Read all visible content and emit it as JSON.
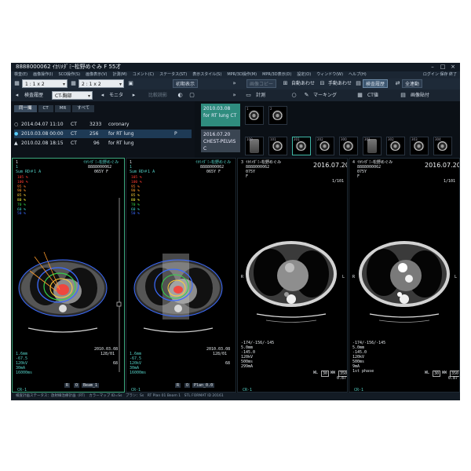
{
  "titlebar": {
    "title": "8888000062  ｲｶﾘﾒﾀﾞﾐｰ松野めぐみ  F   55才"
  },
  "menubar": {
    "items": [
      "検査(E)",
      "画像操作(I)",
      "SCO操作(S)",
      "画像表示(V)",
      "計測(M)",
      "コメント(C)",
      "ステータス(ST)",
      "表示スタイル(S)",
      "MPR/3D操作(M)",
      "MPR/3D表示(D)",
      "設定(O)",
      "ウィンドウ(W)",
      "ヘルプ(H)"
    ],
    "right": "ログイン 保存 終了"
  },
  "toolbar1": {
    "layout1": "1 : 1 x 2",
    "layout2": "2 : 1 x 2",
    "initial_display": "初期表示",
    "series_copy": "画像コピー",
    "auto_fit": "自動あわせ",
    "manual_fit": "手動あわせ",
    "study_history": "検査履歴",
    "full_sync": "全連動"
  },
  "toolbar2": {
    "exam_history": "検査履歴",
    "series_select": "CT-胸部",
    "monitor": "モニタ",
    "compare": "比較読影",
    "measure": "計測",
    "marking": "マーキング",
    "ct_value": "CT値",
    "image_paste": "画像貼付"
  },
  "study_panel": {
    "tabs": [
      "同一撮",
      "CT",
      "MR",
      "すべて"
    ],
    "studies": [
      {
        "date": "2014.04.07 11:10",
        "modality": "CT",
        "count": "3233",
        "desc": "coronary",
        "flag": ""
      },
      {
        "date": "2010.03.08 00:00",
        "modality": "CT",
        "count": "256",
        "desc": "for RT lung",
        "flag": "P"
      },
      {
        "date": "2010.02.08 18:15",
        "modality": "CT",
        "count": "96",
        "desc": "for RT lung",
        "flag": ""
      }
    ]
  },
  "series_bar": {
    "card1": {
      "date": "2010.03.08",
      "desc": "for RT lung CT"
    },
    "card2": {
      "date": "2016.07.20",
      "desc": "CHEST-PELVIS C"
    },
    "thumb_numbers": [
      "1",
      "2",
      "100",
      "101",
      "201",
      "202",
      "300",
      "301",
      "302",
      "303",
      "304"
    ]
  },
  "viewports": {
    "vp1": {
      "index": "1",
      "patient": "ｲｶﾘﾒﾀﾞﾐｰ松野めぐみ",
      "id": "8888000062",
      "age": "065Y F",
      "dose_title": "1",
      "dose_sub": "Sum RD＃1 A",
      "dose_levels": [
        "105 %",
        "100 %",
        "95 %",
        "90 %",
        "85 %",
        "80 %",
        "70 %",
        "60 %",
        "50 %"
      ],
      "date": "2010.03.08",
      "img": "128/01",
      "params": [
        "1.6mm",
        "-67.5",
        "120kV",
        "30mA",
        "16000ms"
      ],
      "wl": "68",
      "btns": [
        "R",
        "O",
        "Beam_1"
      ],
      "series": "CR-1"
    },
    "vp2": {
      "index": "1",
      "patient": "ｲｶﾘﾒﾀﾞﾐｰ松野めぐみ",
      "id": "8888000062",
      "age": "065Y F",
      "dose_title": "1",
      "dose_sub": "Sum RD＃1 A",
      "dose_levels": [
        "105 %",
        "100 %",
        "95 %",
        "90 %",
        "85 %",
        "80 %",
        "70 %",
        "60 %",
        "50 %"
      ],
      "date": "2010.03.08",
      "img": "128/01",
      "params": [
        "1.6mm",
        "-67.5",
        "120kV",
        "30mA",
        "16000ms"
      ],
      "wl": "68",
      "btns": [
        "R",
        "O",
        "Plan_0.0"
      ],
      "series": "CR-1"
    },
    "vp3": {
      "index": "3",
      "patient": "ｲｶﾘﾒﾀﾞﾐｰ松野めぐみ",
      "id": "8888000062",
      "age": "075Y",
      "sex": "F",
      "date": "2016.07.20",
      "page": "1/101",
      "coords": "-174/-156/-145",
      "params": [
        "5.0mm",
        "-145.0",
        "120kV",
        "500ms",
        "299mA"
      ],
      "wl_label": "WL",
      "wl": "30",
      "ww_label": "WW",
      "ww": "350",
      "zoom": "0.87",
      "series": "CR-1"
    },
    "vp4": {
      "index": "4",
      "patient": "ｲｶﾘﾒﾀﾞﾐｰ松野めぐみ",
      "id": "8888000062",
      "age": "075Y",
      "sex": "F",
      "date": "2016.07.20",
      "page": "1/101",
      "coords": "-174/-156/-145",
      "params": [
        "5.0mm",
        "-145.0",
        "120kV",
        "500ms",
        "9mA",
        "1st phase"
      ],
      "wl_label": "WL",
      "wl": "30",
      "ww_label": "WW",
      "ww": "350",
      "zoom": "0.87",
      "series": "CR-1"
    }
  },
  "status": {
    "text": "検査計画ステータス：放射線治療計画（RT）　カラーマップ ID=Ss　プラン：Ss　RT Plan 01 Beam 1　STL FORMAT ID 20161"
  },
  "colors": {
    "accent": "#3da97e",
    "overlay_cyan": "#54d0c6",
    "dose_red": "#ff3b30",
    "dose_green": "#34d34a",
    "dose_blue": "#3b6bff"
  }
}
